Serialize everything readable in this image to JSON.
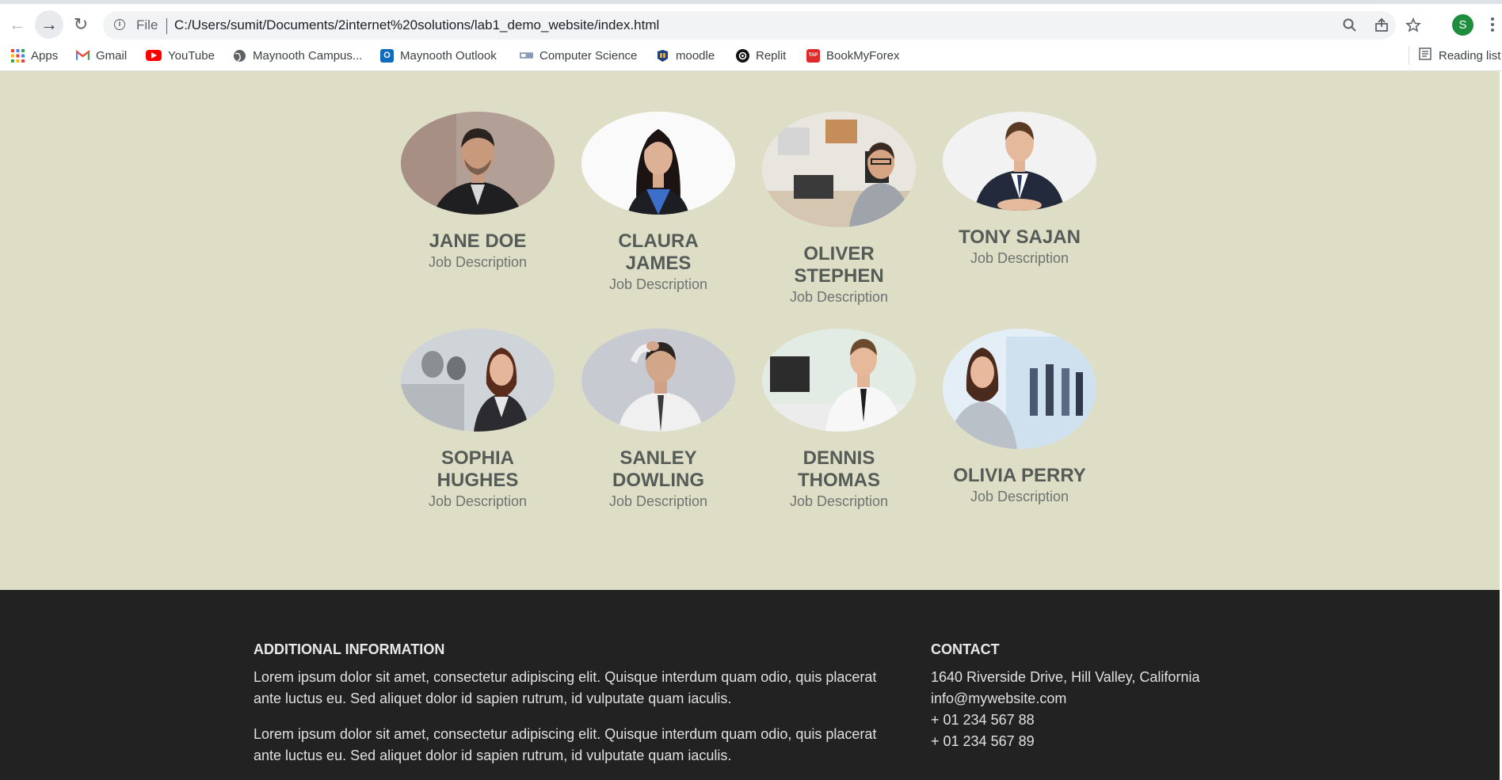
{
  "browser": {
    "file_label": "File",
    "url": "C:/Users/sumit/Documents/2internet%20solutions/lab1_demo_website/index.html",
    "profile_initial": "S",
    "bookmarks": [
      {
        "label": "Apps",
        "icon": "apps-grid-icon"
      },
      {
        "label": "Gmail",
        "icon": "gmail-icon"
      },
      {
        "label": "YouTube",
        "icon": "youtube-icon"
      },
      {
        "label": "Maynooth Campus...",
        "icon": "globe-icon"
      },
      {
        "label": "Maynooth Outlook",
        "icon": "outlook-icon"
      },
      {
        "label": "Computer Science",
        "icon": "computer-science-icon"
      },
      {
        "label": "moodle",
        "icon": "moodle-icon"
      },
      {
        "label": "Replit",
        "icon": "replit-icon"
      },
      {
        "label": "BookMyForex",
        "icon": "bookmyforex-icon"
      }
    ],
    "reading_list": "Reading list"
  },
  "team": {
    "members": [
      {
        "name": "JANE DOE",
        "job": "Job Description"
      },
      {
        "name": "CLAURA JAMES",
        "job": "Job Description"
      },
      {
        "name": "OLIVER STEPHEN",
        "job": "Job Description"
      },
      {
        "name": "TONY SAJAN",
        "job": "Job Description"
      },
      {
        "name": "SOPHIA HUGHES",
        "job": "Job Description"
      },
      {
        "name": "SANLEY DOWLING",
        "job": "Job Description"
      },
      {
        "name": "DENNIS THOMAS",
        "job": "Job Description"
      },
      {
        "name": "OLIVIA PERRY",
        "job": "Job Description"
      }
    ]
  },
  "footer": {
    "additional": {
      "heading": "ADDITIONAL INFORMATION",
      "paragraphs": [
        "Lorem ipsum dolor sit amet, consectetur adipiscing elit. Quisque interdum quam odio, quis placerat ante luctus eu. Sed aliquet dolor id sapien rutrum, id vulputate quam iaculis.",
        "Lorem ipsum dolor sit amet, consectetur adipiscing elit. Quisque interdum quam odio, quis placerat ante luctus eu. Sed aliquet dolor id sapien rutrum, id vulputate quam iaculis."
      ]
    },
    "contact": {
      "heading": "CONTACT",
      "address": "1640 Riverside Drive, Hill Valley, California",
      "email": "info@mywebsite.com",
      "phone1": "+ 01 234 567 88",
      "phone2": "+ 01 234 567 89"
    }
  },
  "colors": {
    "team_bg": "#dedec6",
    "footer_bg": "#222222",
    "name_text": "#555b57"
  }
}
